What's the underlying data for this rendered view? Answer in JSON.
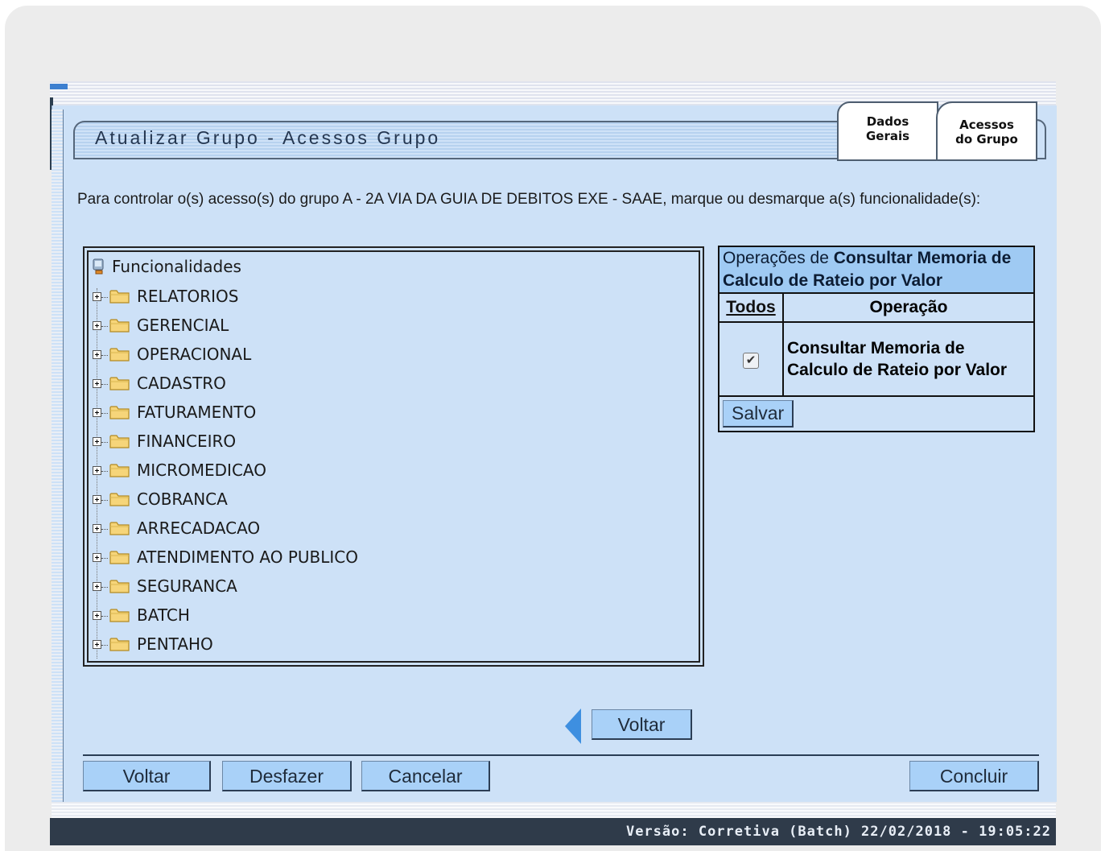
{
  "window": {
    "title": "Atualizar Grupo - Acessos Grupo",
    "version": "Versão: Corretiva (Batch) 22/02/2018 - 19:05:22"
  },
  "tabs": [
    {
      "line1": "Dados",
      "line2": "Gerais"
    },
    {
      "line1": "Acessos",
      "line2": "do Grupo"
    }
  ],
  "instruction": "Para controlar o(s) acesso(s) do grupo A - 2A VIA DA GUIA DE DEBITOS EXE - SAAE, marque ou desmarque a(s) funcionalidade(s):",
  "tree": {
    "root": "Funcionalidades",
    "items": [
      "RELATORIOS",
      "GERENCIAL",
      "OPERACIONAL",
      "CADASTRO",
      "FATURAMENTO",
      "FINANCEIRO",
      "MICROMEDICAO",
      "COBRANCA",
      "ARRECADACAO",
      "ATENDIMENTO AO PUBLICO",
      "SEGURANCA",
      "BATCH",
      "PENTAHO"
    ]
  },
  "operations": {
    "header_prefix": "Operações de ",
    "header_bold": "Consultar Memoria de Calculo de Rateio por Valor",
    "col_all": "Todos",
    "col_op": "Operação",
    "rows": [
      {
        "name": "Consultar Memoria de Calculo de Rateio por Valor",
        "checked": true
      }
    ],
    "save_label": "Salvar"
  },
  "buttons": {
    "voltar_mid": "Voltar",
    "voltar": "Voltar",
    "desfazer": "Desfazer",
    "cancelar": "Cancelar",
    "concluir": "Concluir"
  }
}
